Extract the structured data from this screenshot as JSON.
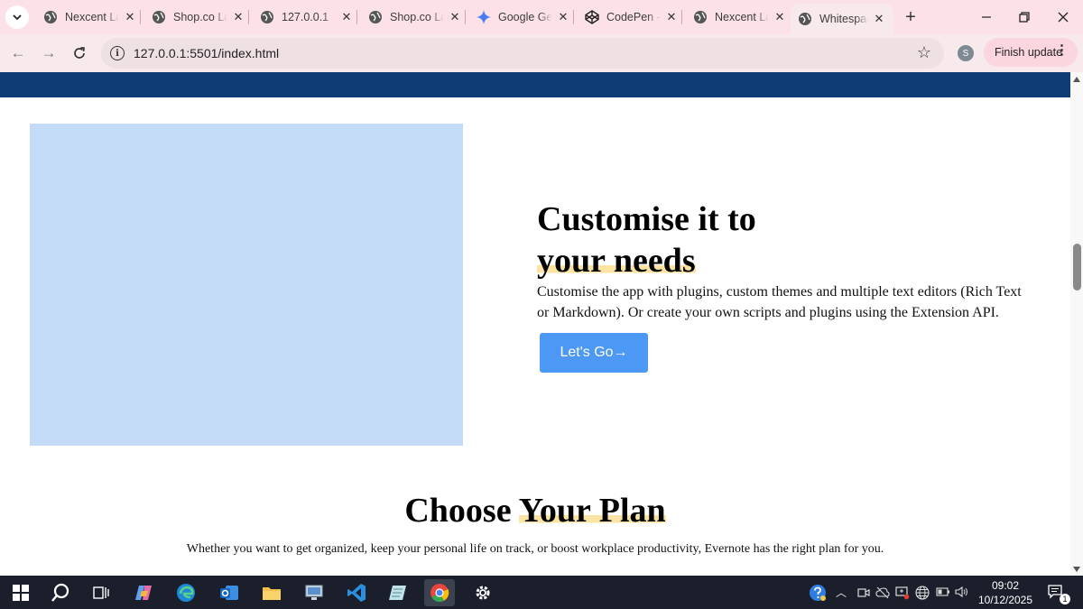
{
  "browser": {
    "tabs": [
      {
        "title": "Nexcent La",
        "icon": "globe-icon"
      },
      {
        "title": "Shop.co La",
        "icon": "globe-icon"
      },
      {
        "title": "127.0.0.1",
        "icon": "globe-icon"
      },
      {
        "title": "Shop.co La",
        "icon": "globe-icon"
      },
      {
        "title": "Google Ge",
        "icon": "gemini-icon"
      },
      {
        "title": "CodePen -",
        "icon": "codepen-icon"
      },
      {
        "title": "Nexcent La",
        "icon": "globe-icon"
      },
      {
        "title": "Whitespac",
        "icon": "globe-icon",
        "active": true
      }
    ],
    "url": "127.0.0.1:5501/index.html",
    "profile_initial": "S",
    "finish_update_label": "Finish update"
  },
  "page": {
    "nav_color": "#0e3c74",
    "feature": {
      "heading_line1": "Customise it to",
      "heading_line2": "your needs",
      "highlight_word": "your needs",
      "body": "Customise the app with plugins, custom themes and multiple text editors (Rich Text or Markdown). Or create your own scripts and plugins using the Extension API.",
      "cta_label": "Let's Go→",
      "cta_color": "#4d98f5",
      "image_color": "#c3dbf7"
    },
    "plans": {
      "title_part1": "Choose ",
      "title_highlight": "Your Plan",
      "subtitle": "Whether you want to get organized, keep your personal life on track, or boost workplace productivity, Evernote has the right plan for you."
    }
  },
  "taskbar": {
    "clock_time": "09:02",
    "clock_date": "10/12/2025",
    "notification_count": "1"
  }
}
